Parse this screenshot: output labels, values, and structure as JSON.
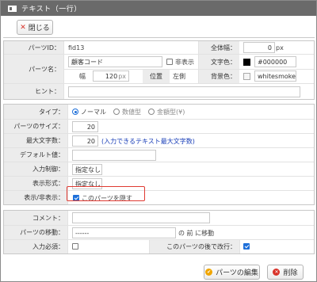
{
  "window": {
    "title": "テキスト（一行）"
  },
  "toolbar": {
    "close_label": "閉じる"
  },
  "basic": {
    "parts_id_label": "パーツID：",
    "parts_id_value": "fid13",
    "width_label": "全体幅：",
    "width_value": "0",
    "width_unit": "px",
    "parts_name_label": "パーツ名：",
    "parts_name_value": "顧客コード",
    "hidden_label": "非表示",
    "text_color_label": "文字色：",
    "text_color_value": "#000000",
    "text_color_swatch": "#000000",
    "size_width_label": "幅",
    "size_width_value": "120",
    "size_width_unit": "px",
    "position_label": "位置",
    "position_value": "左側",
    "bg_color_label": "背景色：",
    "bg_color_value": "whitesmoke",
    "bg_color_swatch": "#f5f5f5",
    "hint_label": "ヒント：",
    "hint_value": ""
  },
  "settings": {
    "type_label": "タイプ：",
    "type_options": [
      "ノーマル",
      "数値型",
      "金額型(¥)"
    ],
    "type_selected": "ノーマル",
    "size_label": "パーツのサイズ：",
    "size_value": "20",
    "maxlen_label": "最大文字数：",
    "maxlen_value": "20",
    "maxlen_note": "(入力できるテキスト最大文字数)",
    "default_label": "デフォルト値：",
    "default_value": "",
    "input_ctrl_label": "入力制御：",
    "input_ctrl_value": "指定なし",
    "display_fmt_label": "表示形式：",
    "display_fmt_value": "指定なし",
    "visibility_label": "表示/非表示：",
    "visibility_checkbox_label": "このパーツを隠す",
    "visibility_checked": true
  },
  "extra": {
    "comment_label": "コメント：",
    "comment_value": "",
    "move_label": "パーツの移動：",
    "move_value": "------",
    "move_suffix": "の 前 に移動",
    "required_label": "入力必須：",
    "newline_label": "このパーツの後で改行：",
    "newline_checked": true
  },
  "footer": {
    "edit_label": "パーツの編集",
    "delete_label": "削除"
  },
  "colors": {
    "accent": "#1e6fd9",
    "highlight_border": "#e03a32",
    "delete_icon": "#d9342b",
    "edit_icon": "#f0a500"
  }
}
